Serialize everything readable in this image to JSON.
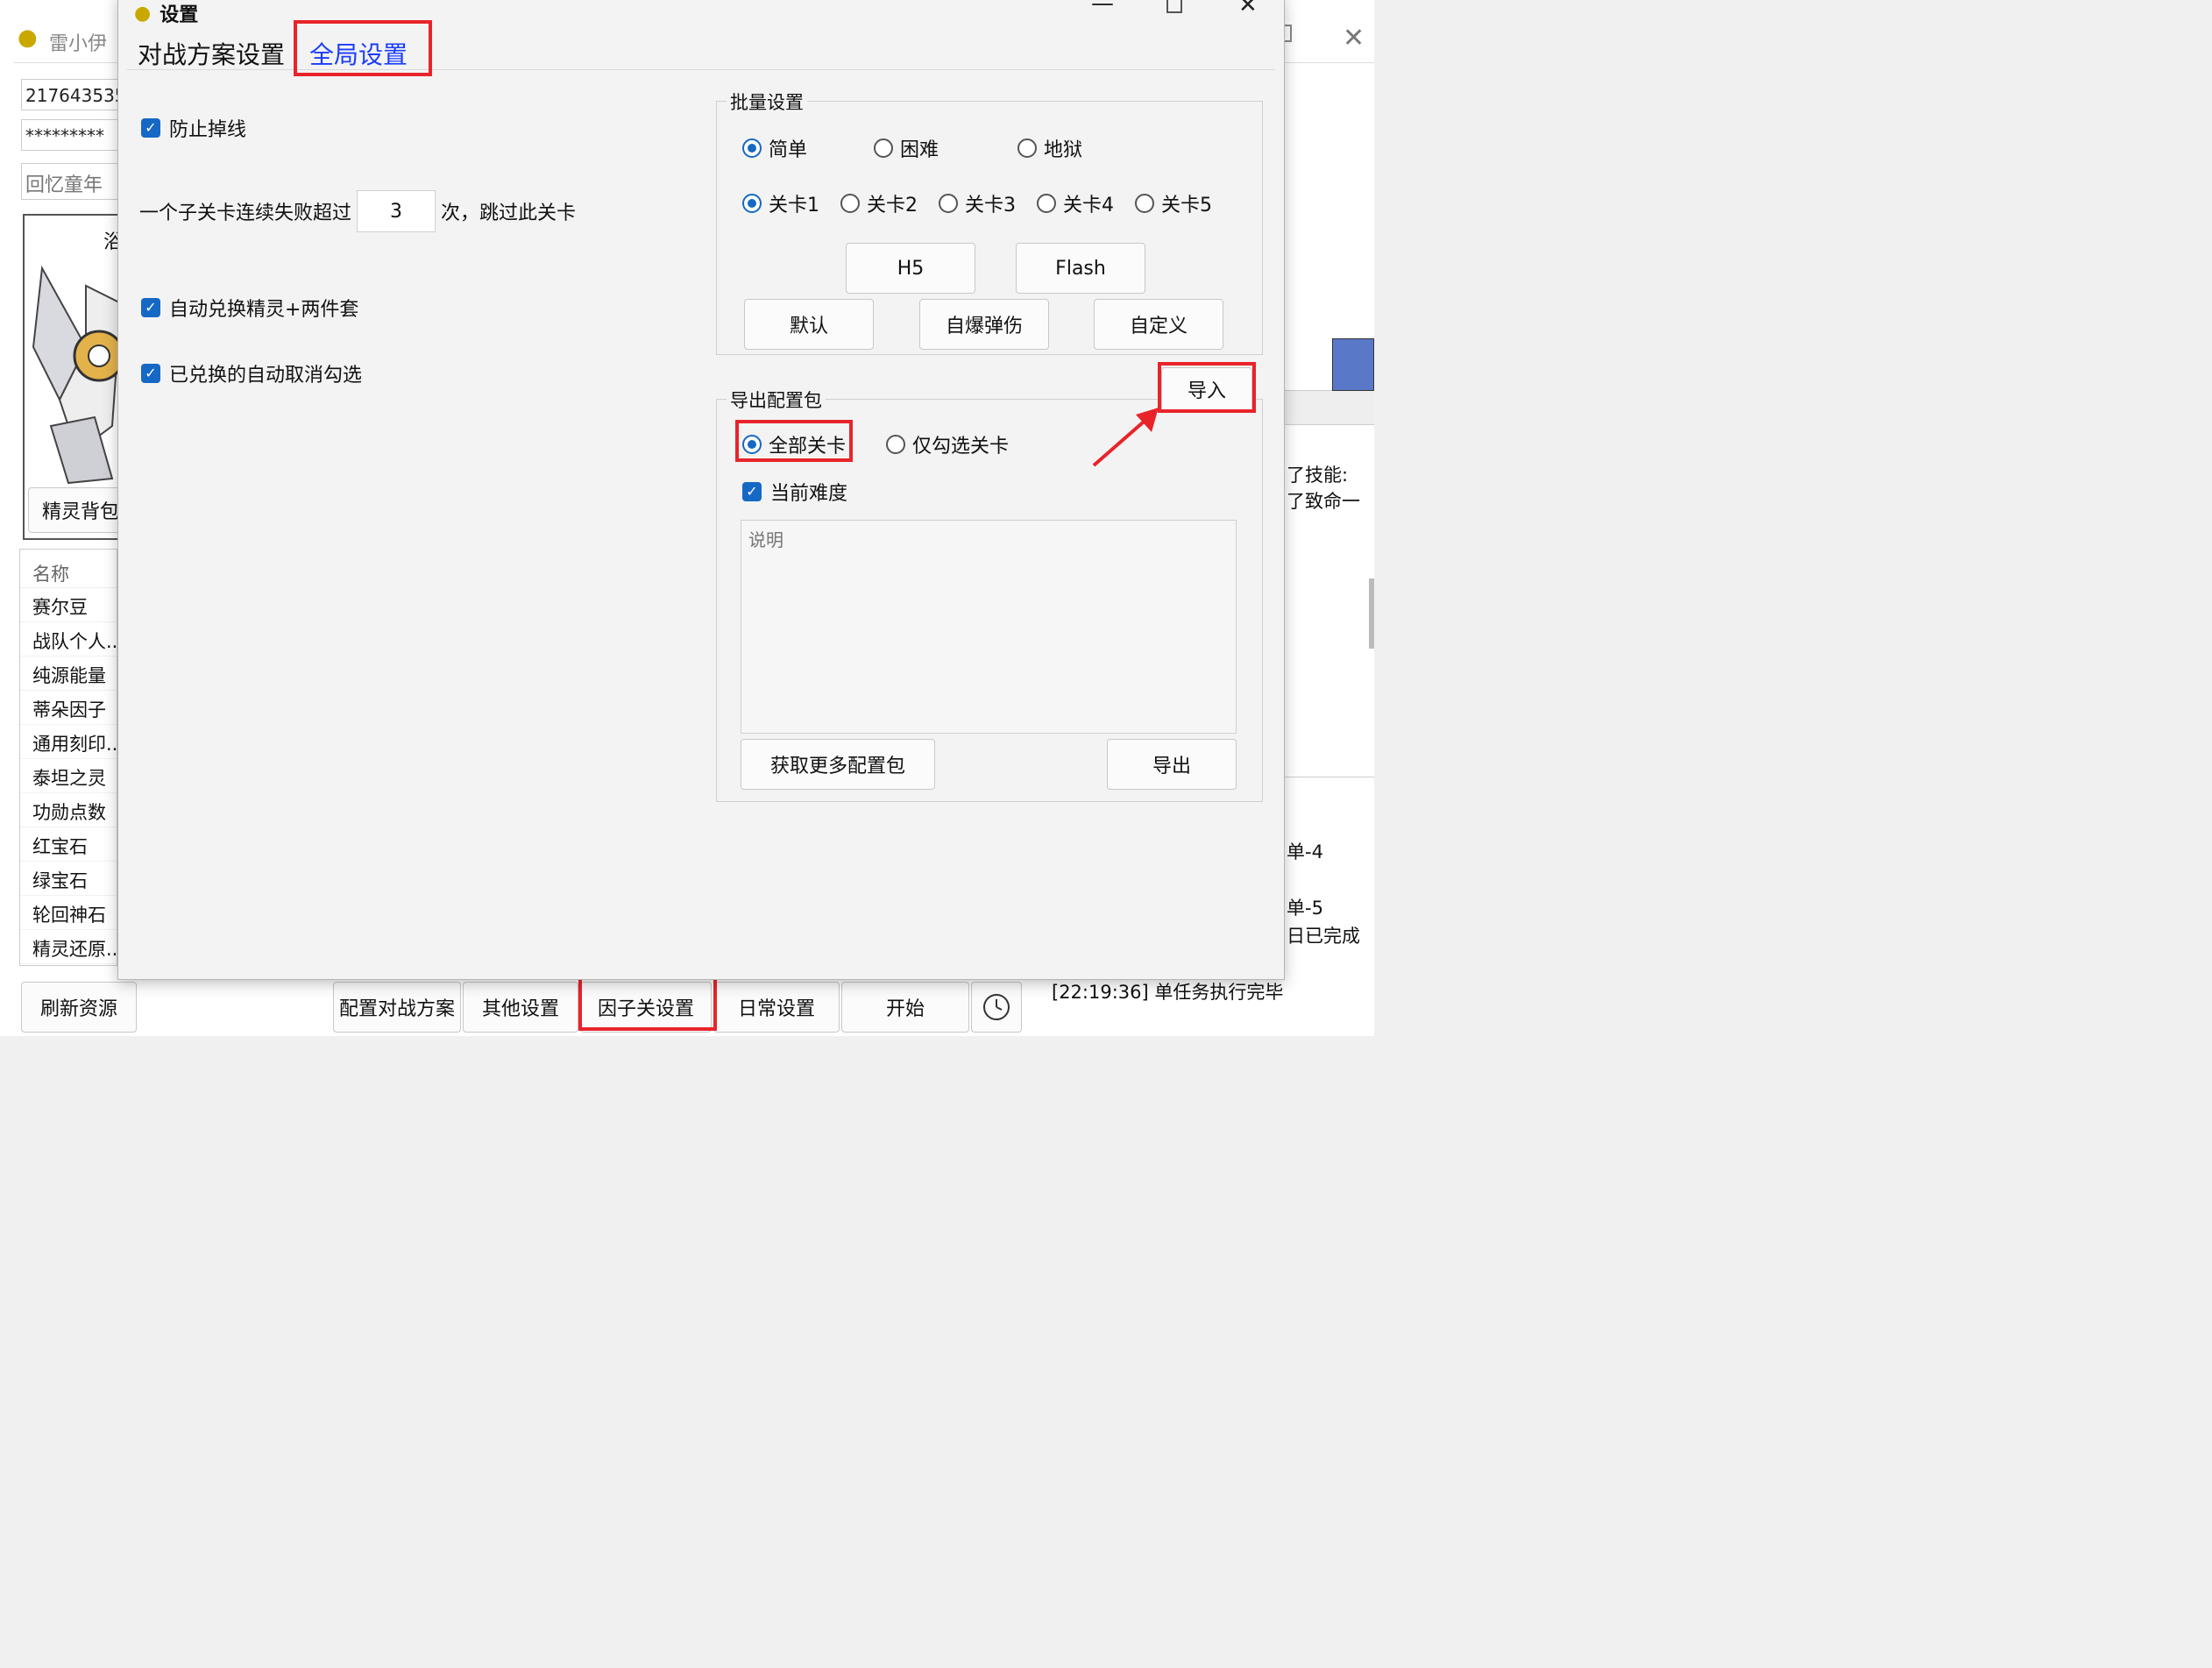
{
  "background_app": {
    "title": "雷小伊",
    "account_field": "217643535",
    "password_field": "*********",
    "nickname_placeholder": "回忆童年",
    "avatar_partial_text": "浴",
    "sprite_bag_button": "精灵背包",
    "resource_list": {
      "header": "名称",
      "items": [
        "赛尔豆",
        "战队个人...",
        "纯源能量",
        "蒂朵因子",
        "通用刻印...",
        "泰坦之灵",
        "功勋点数",
        "红宝石",
        "绿宝石",
        "轮回神石",
        "精灵还原..."
      ]
    },
    "bottom_buttons": {
      "refresh": "刷新资源",
      "config_battle": "配置对战方案",
      "other_settings": "其他设置",
      "factor_settings": "因子关设置",
      "daily_settings": "日常设置",
      "start": "开始"
    },
    "log_lines": [
      "了技能:",
      "了致命一",
      "单-4",
      "单-5",
      "日已完成",
      "[22:19:36] 单任务执行完毕"
    ]
  },
  "dialog": {
    "title": "设置",
    "tabs": [
      {
        "label": "对战方案设置",
        "active": false
      },
      {
        "label": "全局设置",
        "active": true
      }
    ],
    "prevent_disconnect": {
      "label": "防止掉线",
      "checked": true
    },
    "fail_limit": {
      "prefix": "一个子关卡连续失败超过",
      "value": "3",
      "suffix": "次，跳过此关卡"
    },
    "auto_redeem": {
      "label": "自动兑换精灵+两件套",
      "checked": true
    },
    "auto_uncheck": {
      "label": "已兑换的自动取消勾选",
      "checked": true
    },
    "batch": {
      "title": "批量设置",
      "difficulty": [
        {
          "label": "简单",
          "selected": true
        },
        {
          "label": "困难",
          "selected": false
        },
        {
          "label": "地狱",
          "selected": false
        }
      ],
      "stages": [
        {
          "label": "关卡1",
          "selected": true
        },
        {
          "label": "关卡2",
          "selected": false
        },
        {
          "label": "关卡3",
          "selected": false
        },
        {
          "label": "关卡4",
          "selected": false
        },
        {
          "label": "关卡5",
          "selected": false
        }
      ],
      "btn_h5": "H5",
      "btn_flash": "Flash",
      "btn_default": "默认",
      "btn_self_destruct": "自爆弹伤",
      "btn_custom": "自定义"
    },
    "export": {
      "title": "导出配置包",
      "import_button": "导入",
      "scope": [
        {
          "label": "全部关卡",
          "selected": true
        },
        {
          "label": "仅勾选关卡",
          "selected": false
        }
      ],
      "current_difficulty": {
        "label": "当前难度",
        "checked": true
      },
      "description_placeholder": "说明",
      "get_more_button": "获取更多配置包",
      "export_button": "导出"
    }
  },
  "colors": {
    "accent": "#1668c5",
    "highlight": "#e8242a",
    "active_tab": "#1a3cff"
  }
}
